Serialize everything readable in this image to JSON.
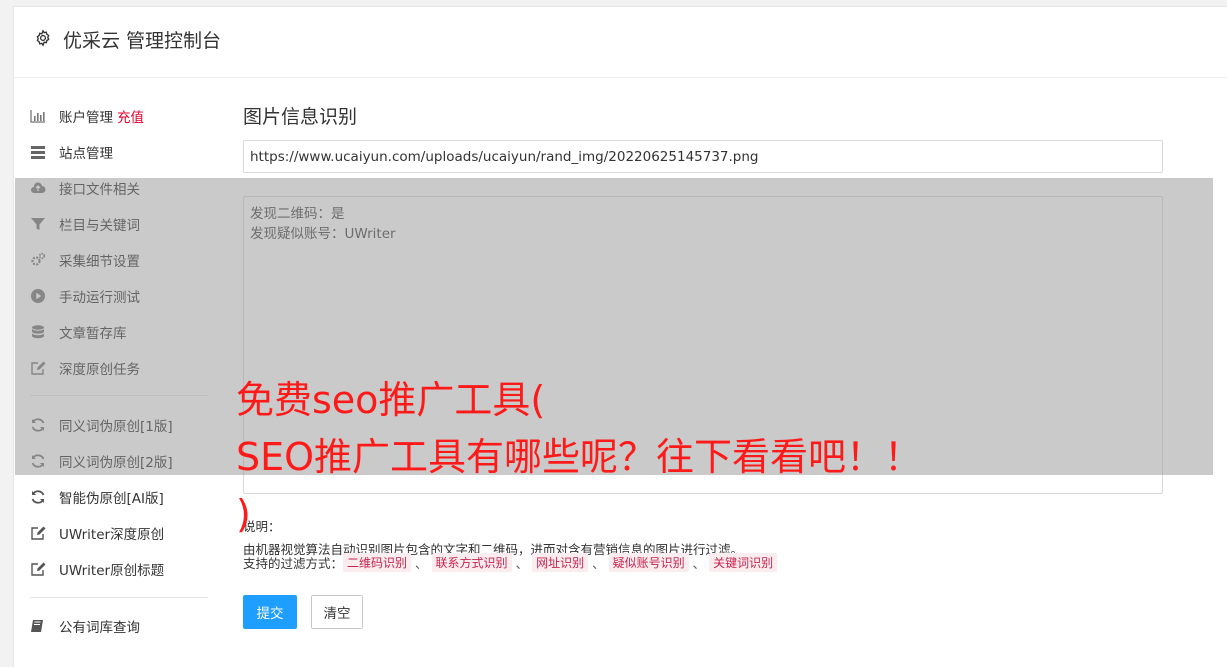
{
  "header": {
    "title": "优采云 管理控制台",
    "icon": "gear-icon"
  },
  "sidebar": {
    "items": [
      {
        "label": "账户管理",
        "badge": "充值",
        "icon": "bar-chart-icon"
      },
      {
        "label": "站点管理",
        "icon": "server-icon"
      },
      {
        "label": "接口文件相关",
        "icon": "cloud-upload-icon"
      },
      {
        "label": "栏目与关键词",
        "icon": "filter-icon"
      },
      {
        "label": "采集细节设置",
        "icon": "gears-icon"
      },
      {
        "label": "手动运行测试",
        "icon": "play-circle-icon"
      },
      {
        "label": "文章暂存库",
        "icon": "database-icon"
      },
      {
        "label": "深度原创任务",
        "icon": "edit-icon"
      },
      {
        "label": "同义词伪原创[1版]",
        "icon": "refresh-icon"
      },
      {
        "label": "同义词伪原创[2版]",
        "icon": "refresh-icon"
      },
      {
        "label": "智能伪原创[AI版]",
        "icon": "refresh-icon"
      },
      {
        "label": "UWriter深度原创",
        "icon": "edit-icon"
      },
      {
        "label": "UWriter原创标题",
        "icon": "edit-icon"
      },
      {
        "label": "公有词库查询",
        "icon": "book-icon"
      }
    ]
  },
  "main": {
    "title": "图片信息识别",
    "url_value": "https://www.ucaiyun.com/uploads/ucaiyun/rand_img/20220625145737.png",
    "result_text": "发现二维码：是\n发现疑似账号：UWriter",
    "note_label": "说明：",
    "note_text": "由机器视觉算法自动识别图片包含的文字和二维码，进而对含有营销信息的图片进行过滤。",
    "filters_label": "支持的过滤方式：",
    "filters": [
      "二维码识别",
      "联系方式识别",
      "网址识别",
      "疑似账号识别",
      "关键词识别"
    ],
    "filter_sep": "、",
    "submit_label": "提交",
    "clear_label": "清空"
  },
  "overlay": {
    "line1": "免费seo推广工具(",
    "line2": "SEO推广工具有哪些呢？往下看看吧！！",
    "line3": ")"
  },
  "colors": {
    "primary": "#1e9fff",
    "badge": "#e4002b",
    "overlay_text": "#ff1a1a",
    "tag_text": "#c7254e"
  }
}
